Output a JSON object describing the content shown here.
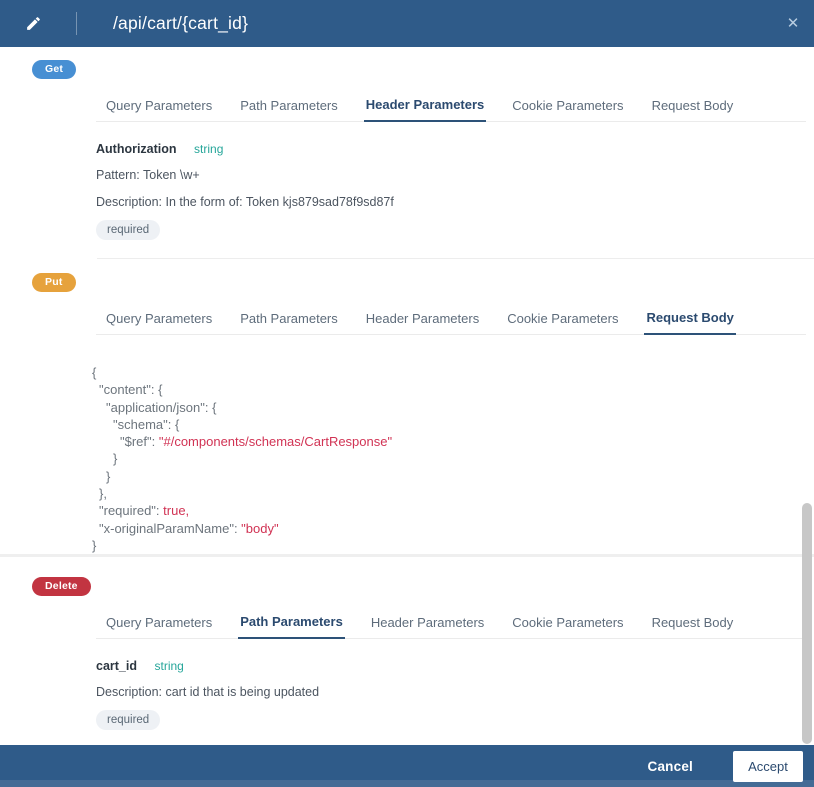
{
  "header": {
    "title": "/api/cart/{cart_id}",
    "close_glyph": "✕"
  },
  "colors": {
    "header_bar": "#2f5b89",
    "get_badge": "#478fd3",
    "put_badge": "#e6a23c",
    "delete_badge": "#c23441",
    "active_tab": "#2b4a6f",
    "type_teal": "#26a69a",
    "json_value_red": "#d13354"
  },
  "tabs": [
    "Query Parameters",
    "Path Parameters",
    "Header Parameters",
    "Cookie Parameters",
    "Request Body"
  ],
  "sections": [
    {
      "method": "Get",
      "badge_color": "#478fd3",
      "active_tab": "Header Parameters",
      "param": {
        "name": "Authorization",
        "type": "string",
        "lines": [
          "Pattern: Token \\w+",
          "Description: In the form of: Token kjs879sad78f9sd87f"
        ],
        "tag": "required"
      }
    },
    {
      "method": "Put",
      "badge_color": "#e6a23c",
      "active_tab": "Request Body",
      "code_lines": [
        {
          "i": 0,
          "s": [
            {
              "t": "{",
              "v": false
            }
          ]
        },
        {
          "i": 1,
          "s": [
            {
              "t": "\"content\": {",
              "v": false
            }
          ]
        },
        {
          "i": 2,
          "s": [
            {
              "t": "\"application/json\": {",
              "v": false
            }
          ]
        },
        {
          "i": 3,
          "s": [
            {
              "t": "\"schema\": {",
              "v": false
            }
          ]
        },
        {
          "i": 4,
          "s": [
            {
              "t": "\"$ref\": ",
              "v": false
            },
            {
              "t": "\"#/components/schemas/CartResponse\"",
              "v": true
            }
          ]
        },
        {
          "i": 3,
          "s": [
            {
              "t": "}",
              "v": false
            }
          ]
        },
        {
          "i": 2,
          "s": [
            {
              "t": "}",
              "v": false
            }
          ]
        },
        {
          "i": 1,
          "s": [
            {
              "t": "},",
              "v": false
            }
          ]
        },
        {
          "i": 1,
          "s": [
            {
              "t": "\"required\": ",
              "v": false
            },
            {
              "t": "true,",
              "v": true
            }
          ]
        },
        {
          "i": 1,
          "s": [
            {
              "t": "\"x-originalParamName\": ",
              "v": false
            },
            {
              "t": "\"body\"",
              "v": true
            }
          ]
        },
        {
          "i": 0,
          "s": [
            {
              "t": "}",
              "v": false
            }
          ]
        }
      ]
    },
    {
      "method": "Delete",
      "badge_color": "#c23441",
      "active_tab": "Path Parameters",
      "param": {
        "name": "cart_id",
        "type": "string",
        "lines": [
          "Description: cart id that is being updated"
        ],
        "tag": "required"
      }
    }
  ],
  "footer": {
    "cancel_label": "Cancel",
    "accept_label": "Accept"
  }
}
